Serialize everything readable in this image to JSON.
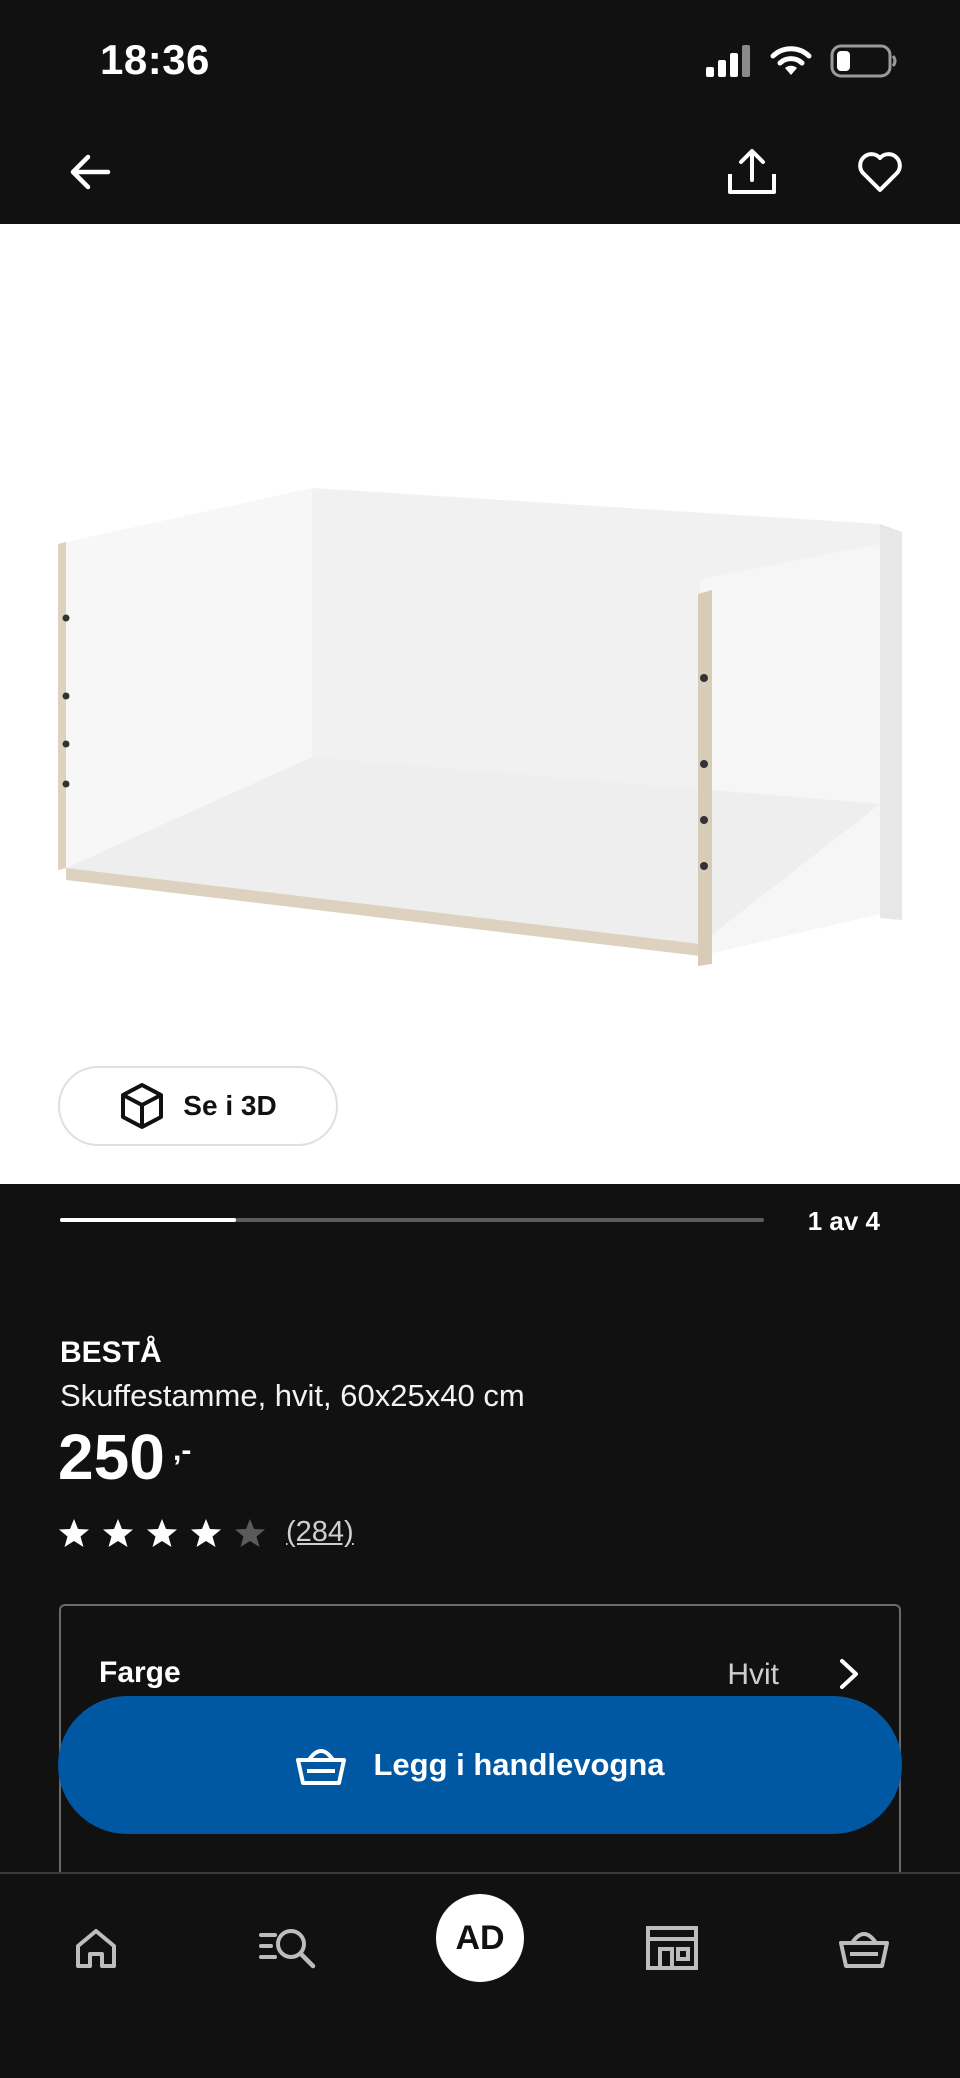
{
  "status_bar": {
    "time": "18:36"
  },
  "product": {
    "brand": "BESTÅ",
    "description": "Skuffestamme, hvit, 60x25x40 cm",
    "price": "250",
    "price_suffix": ",-",
    "rating_value": 4,
    "rating_max": 5,
    "review_count": "(284)",
    "view_3d_label": "Se i 3D",
    "image_counter": "1 av 4",
    "image_index": 1,
    "image_total": 4
  },
  "options": [
    {
      "label": "Farge",
      "value": "Hvit"
    }
  ],
  "cart_button": {
    "label": "Legg i handlevogna"
  },
  "tab_bar": {
    "profile_initials": "AD"
  },
  "colors": {
    "background": "#111111",
    "accent_blue": "#0058a3",
    "text": "#ffffff",
    "star_filled": "#ffffff",
    "star_empty": "#5a5a5a"
  },
  "icons": {
    "back": "arrow-left-icon",
    "share": "share-icon",
    "favorite": "heart-icon",
    "view_3d": "cube-icon",
    "cart_button": "basket-icon",
    "home": "home-icon",
    "search": "search-icon",
    "stores": "store-icon",
    "cart": "cart-icon"
  }
}
